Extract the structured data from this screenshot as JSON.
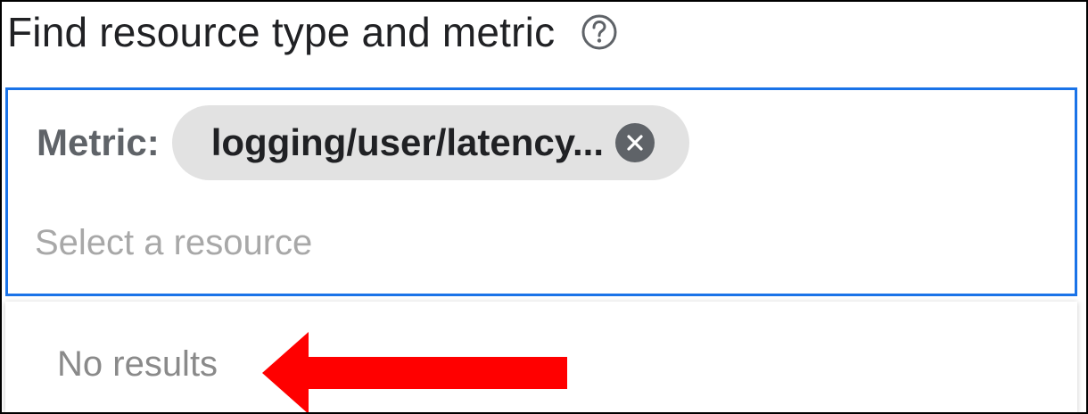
{
  "header": {
    "title": "Find resource type and metric",
    "help_icon": "help-circle-icon"
  },
  "picker": {
    "metric_label": "Metric:",
    "metric_chip_value": "logging/user/latency...",
    "chip_close_icon": "close-circle-icon",
    "resource_placeholder": "Select a resource",
    "resource_value": ""
  },
  "dropdown": {
    "empty_message": "No results"
  },
  "annotation": {
    "arrow_icon": "arrow-left-icon",
    "arrow_color": "#ff0000"
  },
  "colors": {
    "focus_border": "#1a73e8",
    "chip_background": "#e2e2e2",
    "chip_close": "#5f6368",
    "placeholder_text": "#a8a8a8",
    "muted_text": "#8a8a8a"
  }
}
